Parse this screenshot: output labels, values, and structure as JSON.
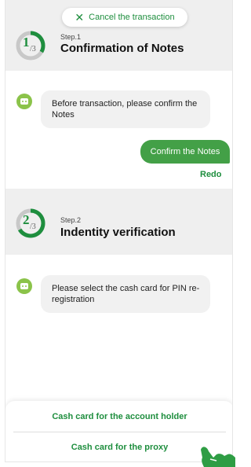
{
  "cancel": {
    "icon": "close-icon",
    "label": "Cancel the transaction"
  },
  "step1": {
    "label": "Step.1",
    "title": "Confirmation of Notes",
    "progress_num": "1",
    "progress_total": "3",
    "progress_fraction": 0.333
  },
  "chat1": {
    "bot_icon": "bot-icon",
    "message": "Before transaction, please confirm the Notes"
  },
  "confirm_button": {
    "label": "Confirm the Notes"
  },
  "redo": {
    "label": "Redo"
  },
  "step2": {
    "label": "Step.2",
    "title": "Indentity verification",
    "progress_num": "2",
    "progress_total": "3",
    "progress_fraction": 0.667
  },
  "chat2": {
    "bot_icon": "bot-icon",
    "message": "Please select the cash card for PIN re-registration"
  },
  "sheet": {
    "options": [
      "Cash card for the account holder",
      "Cash card for the proxy"
    ]
  },
  "hand_icon": "pointing-hand-icon",
  "colors": {
    "accent": "#1e8e3e",
    "button_green": "#43a047",
    "bot_green": "#8bc34a",
    "band": "#efefef",
    "bubble": "#f1f1f1"
  }
}
